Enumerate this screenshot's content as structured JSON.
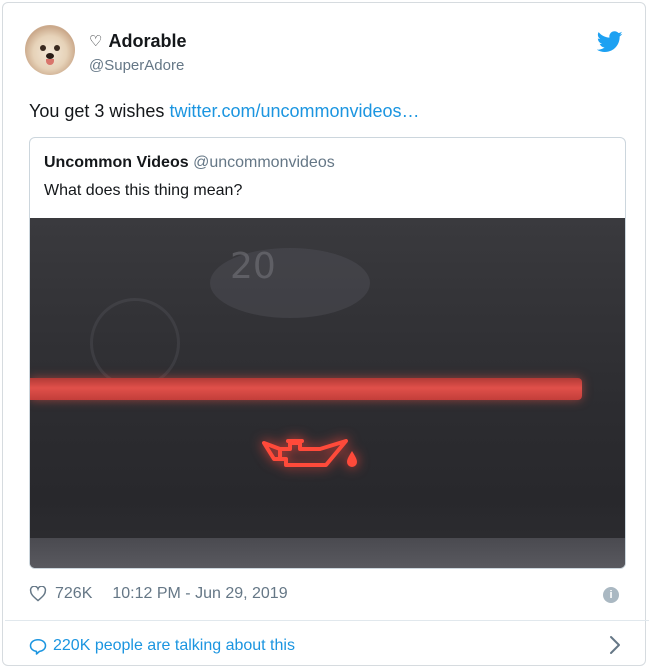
{
  "author": {
    "display_name": "Adorable",
    "handle": "@SuperAdore",
    "avatar_icon": "pomeranian-avatar",
    "name_prefix_icon": "heart-outline-icon"
  },
  "tweet": {
    "text": "You get 3 wishes ",
    "link_text": "twitter.com/uncommonvideos…"
  },
  "quote": {
    "name": "Uncommon Videos",
    "handle": "@uncommonvideos",
    "text": "What does this thing mean?",
    "media_icon": "oil-pressure-warning-icon"
  },
  "footer": {
    "likes": "726K",
    "timestamp": "10:12 PM - Jun 29, 2019",
    "info_glyph": "i"
  },
  "talking": {
    "text": "220K people are talking about this"
  },
  "colors": {
    "link": "#1b95e0",
    "brand": "#1da1f2",
    "muted": "#657786"
  }
}
